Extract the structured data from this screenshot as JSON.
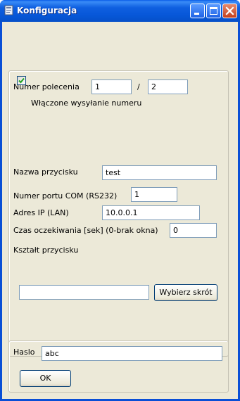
{
  "window": {
    "title": "Konfiguracja"
  },
  "colors": {
    "titlebar": "#0a5de8",
    "client_bg": "#ece9d8",
    "close_button": "#c6401d",
    "checkmark": "#21a121",
    "field_border": "#7f9db9"
  },
  "form": {
    "command_number_label": "Numer polecenia",
    "command_number_value": "1",
    "separator": "/",
    "command_total_value": "2",
    "send_number_checkbox_label": "Włączone wysyłanie numeru",
    "send_number_checked": true,
    "button_name_label": "Nazwa przycisku",
    "button_name_value": "test",
    "com_port_label": "Numer portu COM (RS232)",
    "com_port_value": "1",
    "ip_label": "Adres IP (LAN)",
    "ip_value": "10.0.0.1",
    "timeout_label": "Czas oczekiwania [sek] (0-brak okna)",
    "timeout_value": "0",
    "shape_label": "Kształt przycisku",
    "shortcut_value": "",
    "choose_shortcut_button": "Wybierz skrót"
  },
  "password": {
    "label": "Haslo",
    "value": "abc",
    "ok_button": "OK"
  }
}
